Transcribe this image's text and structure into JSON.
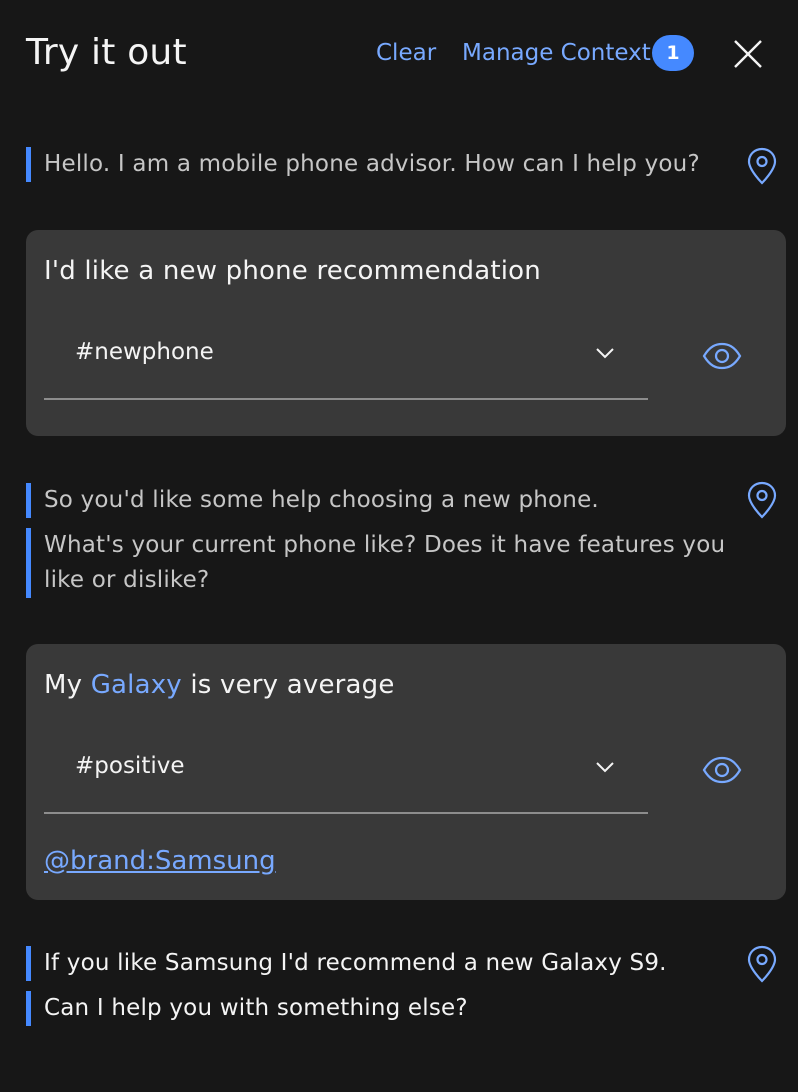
{
  "header": {
    "title": "Try it out",
    "clear_label": "Clear",
    "manage_context_label": "Manage Context",
    "context_count": "1"
  },
  "conversation": {
    "bot_1": {
      "lines": [
        "Hello. I am a mobile phone advisor. How can I help you?"
      ]
    },
    "user_1": {
      "text": "I'd like a new phone recommendation",
      "intent": "#newphone"
    },
    "bot_2": {
      "lines": [
        "So you'd like some help choosing a new phone.",
        "What's your current phone like? Does it have features you",
        "like or dislike?"
      ]
    },
    "user_2": {
      "text_before": "My ",
      "entity_word": "Galaxy",
      "text_after": " is very average",
      "intent": "#positive",
      "entity": "@brand:Samsung"
    },
    "bot_3": {
      "lines": [
        "If you like Samsung I'd recommend a new Galaxy S9.",
        "Can I help you with something else?"
      ]
    }
  },
  "icons": [
    "close-icon",
    "location-pin-icon",
    "chevron-down-icon",
    "eye-icon"
  ],
  "colors": {
    "background": "#171717",
    "card": "#393939",
    "accent": "#78a9ff",
    "marker": "#4589ff",
    "badge": "#4589ff"
  }
}
